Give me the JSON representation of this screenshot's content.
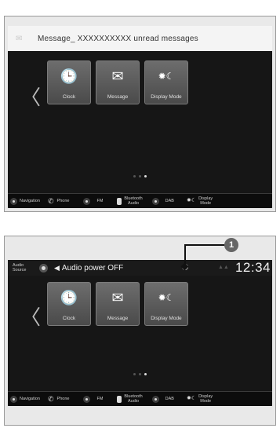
{
  "screen1": {
    "message_bar": {
      "text": "Message_ XXXXXXXXXX unread messages"
    },
    "tiles": [
      {
        "label": "Clock",
        "icon": "clock-icon"
      },
      {
        "label": "Message",
        "icon": "mail-icon"
      },
      {
        "label": "Display Mode",
        "icon": "display-mode-icon"
      }
    ],
    "page_dots": {
      "count": 3,
      "active": 3
    },
    "nav": [
      {
        "label": "Navigation",
        "icon": "navigation-icon"
      },
      {
        "label": "Phone",
        "icon": "phone-icon"
      },
      {
        "label": "FM",
        "icon": "fm-icon"
      },
      {
        "label": "Bluetooth\nAudio",
        "icon": "bluetooth-icon"
      },
      {
        "label": "DAB",
        "icon": "dab-icon"
      },
      {
        "label": "Display\nMode",
        "icon": "display-mode-icon"
      }
    ]
  },
  "screen2": {
    "status_bar": {
      "audio_source": "Audio\nSource",
      "audio_power": "Audio power OFF",
      "clock": "12:34"
    },
    "callout_number": "1",
    "tiles": [
      {
        "label": "Clock",
        "icon": "clock-icon"
      },
      {
        "label": "Message",
        "icon": "mail-icon"
      },
      {
        "label": "Display Mode",
        "icon": "display-mode-icon"
      }
    ],
    "page_dots": {
      "count": 3,
      "active": 3
    },
    "nav": [
      {
        "label": "Navigation",
        "icon": "navigation-icon"
      },
      {
        "label": "Phone",
        "icon": "phone-icon"
      },
      {
        "label": "FM",
        "icon": "fm-icon"
      },
      {
        "label": "Bluetooth\nAudio",
        "icon": "bluetooth-icon"
      },
      {
        "label": "DAB",
        "icon": "dab-icon"
      },
      {
        "label": "Display\nMode",
        "icon": "display-mode-icon"
      }
    ]
  }
}
